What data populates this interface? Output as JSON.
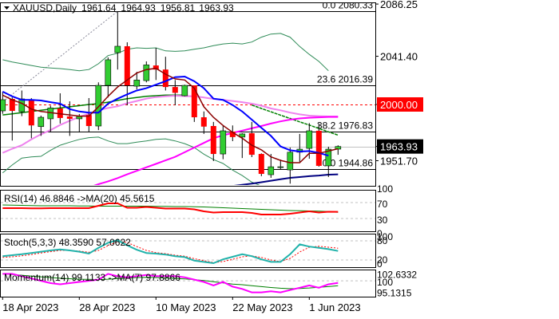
{
  "chart_data": {
    "type": "candlestick",
    "title": "XAUUSD,Daily",
    "ohlc_header": {
      "open": "1961.64",
      "high": "1964.93",
      "low": "1956.81",
      "close": "1963.93"
    },
    "colors": {
      "up": "#32cd32",
      "down": "#ff0000",
      "ma_blue": "#0000ff",
      "ma_darkred": "#8b0000",
      "ma_pink": "#ee82ee",
      "ma_magenta": "#ff00ff",
      "ma_navy": "#000080",
      "bands": "#2e8b57",
      "ma_green": "#008000"
    },
    "ylim": [
      1925,
      2090
    ],
    "candles": [
      {
        "o": 1994.5,
        "h": 2011,
        "l": 1992,
        "c": 2004.1
      },
      {
        "o": 2004.8,
        "h": 2006,
        "l": 1969,
        "c": 1994.5
      },
      {
        "o": 1993.8,
        "h": 2012,
        "l": 1990,
        "c": 2004.8
      },
      {
        "o": 2003.4,
        "h": 2005.5,
        "l": 1971,
        "c": 1982
      },
      {
        "o": 1981,
        "h": 1990.4,
        "l": 1973,
        "c": 1989
      },
      {
        "o": 1987.7,
        "h": 1999,
        "l": 1976,
        "c": 1997
      },
      {
        "o": 1996.6,
        "h": 2009.6,
        "l": 1983.6,
        "c": 1988.4
      },
      {
        "o": 1989.7,
        "h": 2002.7,
        "l": 1973,
        "c": 1987.7
      },
      {
        "o": 1987.7,
        "h": 1991.8,
        "l": 1976,
        "c": 1989.7
      },
      {
        "o": 1991,
        "h": 2005.5,
        "l": 1976.7,
        "c": 1981.5
      },
      {
        "o": 1981.5,
        "h": 2019,
        "l": 1978,
        "c": 2016.4
      },
      {
        "o": 2016.4,
        "h": 2040.4,
        "l": 2006,
        "c": 2038.4
      },
      {
        "o": 2044.5,
        "h": 2079.5,
        "l": 2030,
        "c": 2050
      },
      {
        "o": 2050,
        "h": 2053.4,
        "l": 1999.3,
        "c": 2016.4
      },
      {
        "o": 2015.7,
        "h": 2028,
        "l": 2013,
        "c": 2021
      },
      {
        "o": 2020.5,
        "h": 2037,
        "l": 2019,
        "c": 2034
      },
      {
        "o": 2033.5,
        "h": 2048.6,
        "l": 2021,
        "c": 2030
      },
      {
        "o": 2030,
        "h": 2041,
        "l": 2012,
        "c": 2015
      },
      {
        "o": 2015,
        "h": 2021,
        "l": 1999.3,
        "c": 2010
      },
      {
        "o": 2007.5,
        "h": 2017,
        "l": 2007,
        "c": 2016.4
      },
      {
        "o": 2016.4,
        "h": 2016.4,
        "l": 1985,
        "c": 1989
      },
      {
        "o": 1989,
        "h": 1994,
        "l": 1974.7,
        "c": 1981
      },
      {
        "o": 1981.5,
        "h": 1985,
        "l": 1951.4,
        "c": 1957.5
      },
      {
        "o": 1957.5,
        "h": 1982,
        "l": 1953,
        "c": 1977.4
      },
      {
        "o": 1976.7,
        "h": 1982,
        "l": 1968.5,
        "c": 1972
      },
      {
        "o": 1972,
        "h": 1975.3,
        "l": 1954,
        "c": 1974.7
      },
      {
        "o": 1975.3,
        "h": 1985,
        "l": 1954.8,
        "c": 1956.8
      },
      {
        "o": 1957.5,
        "h": 1958,
        "l": 1938.4,
        "c": 1940.4
      },
      {
        "o": 1939.7,
        "h": 1957.5,
        "l": 1937,
        "c": 1946.5
      },
      {
        "o": 1946,
        "h": 1952.7,
        "l": 1944,
        "c": 1946.5
      },
      {
        "o": 1943.8,
        "h": 1963,
        "l": 1932,
        "c": 1959
      },
      {
        "o": 1959,
        "h": 1974.7,
        "l": 1950.7,
        "c": 1961.6
      },
      {
        "o": 1962.3,
        "h": 1984,
        "l": 1953.4,
        "c": 1977.4
      },
      {
        "o": 1977.4,
        "h": 1983.6,
        "l": 1946.6,
        "c": 1947.3
      },
      {
        "o": 1947.3,
        "h": 1963.7,
        "l": 1937.7,
        "c": 1961.6
      },
      {
        "o": 1961.64,
        "h": 1964.93,
        "l": 1956.81,
        "c": 1963.93
      }
    ],
    "overlays": {
      "ma_darkred": [
        2008,
        2004,
        2001,
        1996,
        1994,
        1993,
        1992,
        1991,
        1990,
        1990,
        1998,
        2007,
        2015,
        2021,
        2027,
        2030,
        2031,
        2026,
        2022,
        2021,
        2014,
        1998,
        1989,
        1982,
        1976,
        1971,
        1965,
        1961,
        1955,
        1952,
        1950,
        1950,
        1958,
        1958,
        1960,
        1962
      ],
      "ma_blue": [
        2011,
        2007,
        2004,
        2004,
        2003.4,
        2002,
        2000.7,
        1996,
        1994,
        1993,
        1993,
        2000.7,
        2005,
        2008.7,
        2012,
        2014,
        2017,
        2020,
        2023.5,
        2024,
        2020,
        2014,
        2005,
        2004,
        1999.5,
        1994,
        1987,
        1980,
        1973,
        1964,
        1960.7,
        1959.6,
        1960,
        1958.4,
        1956,
        null
      ],
      "ma_pink": [
        1958.4,
        1962,
        1965,
        1970,
        1974.4,
        1978,
        1982.4,
        1986,
        1989.3,
        1992,
        1995,
        1997,
        1998.4,
        2001,
        2003,
        2005,
        2006.4,
        2007,
        2007.5,
        2007.2,
        2007,
        2006,
        2004.8,
        2004,
        2003,
        2002,
        2000.7,
        1999,
        1996.6,
        1995,
        1993,
        1991.5,
        1990.4,
        1990,
        1989.7,
        1989.7
      ],
      "ma_magenta": [
        null,
        null,
        null,
        null,
        null,
        null,
        null,
        null,
        null,
        1928.8,
        1931.5,
        1934,
        1936.8,
        1940,
        1943,
        1946,
        1949,
        1952,
        1955,
        1959,
        1963,
        1967,
        1971,
        1973.5,
        1975.6,
        1977.5,
        1979.5,
        1981.5,
        1983.6,
        1985.5,
        1987,
        1988,
        1988.6,
        1989,
        1989.3,
        1989.3
      ],
      "ma_navy": [
        null,
        null,
        null,
        null,
        null,
        null,
        null,
        null,
        null,
        null,
        null,
        null,
        null,
        null,
        null,
        null,
        null,
        null,
        null,
        null,
        null,
        null,
        1928,
        1929,
        1930,
        1931,
        1932,
        1933.2,
        1934.5,
        1935.8,
        1937,
        1937.7,
        1938.4,
        1939,
        1939.7,
        1940
      ],
      "band_upper": [
        2038.4,
        2036.5,
        2035,
        2033.5,
        2032,
        2031.4,
        2030.8,
        2030,
        2029,
        2030,
        2035,
        2042,
        2044,
        2047.5,
        2048.6,
        2048.2,
        2048.6,
        2046,
        2045.6,
        2046,
        2047.5,
        2048.6,
        2050.5,
        2052,
        2052.7,
        2052,
        2053.6,
        2057.8,
        2060.5,
        2061,
        2057.8,
        2049.8,
        2043,
        2037,
        2029,
        null
      ],
      "band_lower": [
        1941.3,
        1948,
        1954,
        1955,
        1955.5,
        1960.7,
        1965,
        1967.6,
        1970,
        1971.5,
        1972,
        1968.7,
        1966.4,
        1966.4,
        1967.6,
        1968.7,
        1970,
        1970.5,
        1968.7,
        1966.4,
        1963,
        1957.3,
        1952.7,
        1949.3,
        1943.6,
        1939,
        1933.3,
        1930,
        1927.7,
        1925.3,
        null,
        null,
        null,
        null,
        null,
        null
      ],
      "ma_green": [
        1991,
        1992,
        1993,
        1994,
        1995,
        1996,
        1997,
        1998,
        1999,
        2000,
        2000.7,
        2002,
        2003.5,
        2005,
        2006,
        2007,
        2007.5,
        2008,
        2008,
        2008,
        null,
        null,
        null,
        null,
        null,
        null,
        null,
        null,
        null,
        null,
        null,
        null,
        null,
        null,
        null,
        null
      ],
      "trend_green": [
        null,
        null,
        null,
        null,
        null,
        null,
        null,
        null,
        null,
        null,
        null,
        null,
        null,
        null,
        null,
        null,
        null,
        null,
        null,
        null,
        null,
        null,
        null,
        null,
        null,
        null,
        1999.5,
        1996.6,
        1993.7,
        1990.8,
        1988,
        1985.1,
        1982.3,
        1979.4,
        1976.5,
        1973.7
      ],
      "trend_grey": {
        "from": [
          -0.5,
          1999
        ],
        "to": [
          12,
          2080
        ]
      }
    },
    "levels": [
      {
        "label": "0.0 2080.33",
        "price": 2080.33,
        "color": "#000000",
        "style": "solid"
      },
      {
        "label": "23.6 2016.39",
        "price": 2016.39,
        "color": "#000000",
        "style": "solid"
      },
      {
        "label": "38.2 1976.83",
        "price": 1976.83,
        "color": "#000000",
        "style": "solid"
      },
      {
        "label": "0.0 1944.86",
        "price": 1944.86,
        "color": "#000000",
        "style": "solid"
      },
      {
        "label": "",
        "price": 2000,
        "color": "#ff0000",
        "style": "dashed"
      },
      {
        "label": "",
        "price": 1963.93,
        "color": "#c0c0c0",
        "style": "solid"
      }
    ],
    "price_axis": [
      {
        "label": "2086.25",
        "price": 2086.25,
        "badge": ""
      },
      {
        "label": "2041.40",
        "price": 2041.4,
        "badge": ""
      },
      {
        "label": "2000.00",
        "price": 2000,
        "badge": "#ff0000"
      },
      {
        "label": "1963.93",
        "price": 1963.93,
        "badge": "#000000"
      },
      {
        "label": "1951.70",
        "price": 1951.7,
        "badge": ""
      }
    ],
    "x_labels": [
      {
        "label": "18 Apr 2023",
        "index": 0
      },
      {
        "label": "28 Apr 2023",
        "index": 8
      },
      {
        "label": "10 May 2023",
        "index": 16
      },
      {
        "label": "22 May 2023",
        "index": 24
      },
      {
        "label": "1 Jun 2023",
        "index": 32
      }
    ],
    "rsi": {
      "label": "RSI(14) 46.8846  ->MA(20) 45.5615",
      "ticks": [
        "100",
        "70",
        "30",
        "0"
      ],
      "ylim": [
        0,
        100
      ],
      "values": [
        56,
        56,
        56,
        55.5,
        55.5,
        56,
        56,
        56,
        56,
        56,
        62,
        68,
        68,
        57,
        57,
        59,
        57,
        55,
        55,
        55,
        53,
        48,
        45,
        46,
        46,
        46,
        44,
        40,
        40,
        40,
        42,
        45,
        48,
        45,
        47,
        46.88
      ],
      "ma": [
        64,
        63.5,
        63,
        62.5,
        62,
        62,
        62,
        62,
        61.5,
        61.5,
        61,
        61,
        61,
        61,
        61,
        61,
        60.5,
        60.5,
        60,
        60,
        59.5,
        59,
        58,
        57,
        56,
        55,
        54,
        53,
        52,
        51,
        50,
        49.5,
        49,
        48.5,
        47.5,
        45.56
      ]
    },
    "stoch": {
      "label": "Stoch(5,3,3) 48.3590 57.0622",
      "ticks": [
        "80",
        "100",
        "20",
        "0"
      ],
      "ylim": [
        0,
        100
      ],
      "k": [
        32,
        35,
        38,
        42,
        46,
        50,
        53,
        50,
        46,
        40,
        58,
        74,
        82,
        66,
        52,
        42,
        40,
        37,
        32,
        29,
        18,
        14,
        10,
        22,
        30,
        38,
        32,
        22,
        14,
        14,
        38,
        69,
        62,
        58,
        54,
        48.36
      ],
      "d": [
        28,
        30,
        33,
        37,
        42,
        46,
        50,
        50,
        48,
        44,
        50,
        65,
        78,
        75,
        62,
        50,
        43,
        40,
        35,
        32,
        24,
        18,
        12,
        15,
        22,
        30,
        33,
        28,
        20,
        15,
        25,
        45,
        60,
        63,
        60,
        57.06
      ]
    },
    "momentum": {
      "label": "Momentum(14) 99.1133  ->MA(7) 97.8866",
      "ticks": [
        "102.6332",
        "100",
        "95.1315"
      ],
      "ylim": [
        93.5,
        104.5
      ],
      "values": [
        103,
        103,
        102,
        101,
        100,
        99,
        98.5,
        99,
        99.5,
        100,
        100.5,
        103,
        102,
        101.5,
        102,
        102.5,
        102,
        102,
        102,
        101.5,
        100.5,
        99.5,
        98,
        99.5,
        97.5,
        96.5,
        95,
        95,
        95.5,
        95,
        96,
        97,
        98,
        97,
        98.5,
        99.11
      ],
      "ma": [
        103,
        102.7,
        102.4,
        102,
        101.7,
        101.4,
        101.1,
        100.9,
        100.7,
        100.6,
        100.5,
        100.7,
        101,
        101.2,
        101.4,
        101.5,
        101.4,
        101.2,
        101,
        100.8,
        100.5,
        100.1,
        99.6,
        99.1,
        98.6,
        98.3,
        97.9,
        97.5,
        97.1,
        96.8,
        96.6,
        96.7,
        96.9,
        97.2,
        97.5,
        97.89
      ]
    }
  }
}
